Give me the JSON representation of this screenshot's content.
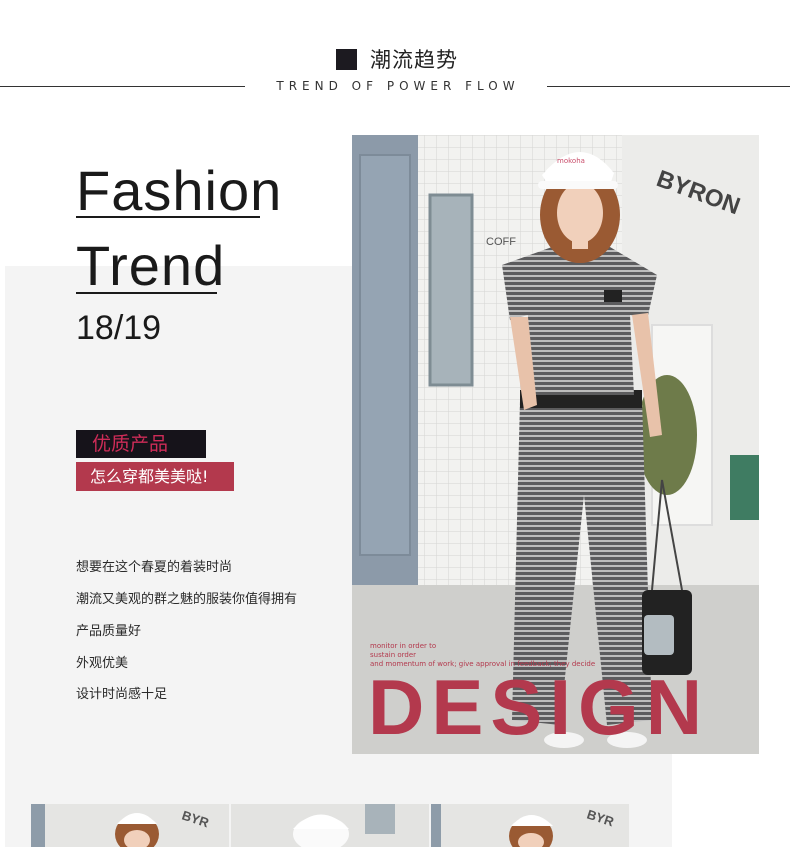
{
  "header": {
    "title": "潮流趋势",
    "subtitle": "TREND OF POWER FLOW"
  },
  "hero": {
    "word1": "Fashion",
    "word2": "Trend",
    "year": "18/19"
  },
  "badges": {
    "primary": "优质产品",
    "secondary": "怎么穿都美美哒!"
  },
  "description": [
    "想要在这个春夏的着装时尚",
    "潮流又美观的群之魅的服装你值得拥有",
    "产品质量好",
    "外观优美",
    "设计时尚感十足"
  ],
  "photo": {
    "caption_lines": [
      "monitor in order to",
      "sustain order",
      "and momentum of work; give approval in feedback; they decide"
    ],
    "design_text": "DESIGN",
    "sign_text": "BYRON",
    "cafe_text": "COFF",
    "cap_text": "mokoha"
  },
  "colors": {
    "accent_red": "#b3394d",
    "badge_dark": "#16131a",
    "badge_pink_text": "#cf2c58",
    "panel_gray": "#f4f4f4"
  }
}
